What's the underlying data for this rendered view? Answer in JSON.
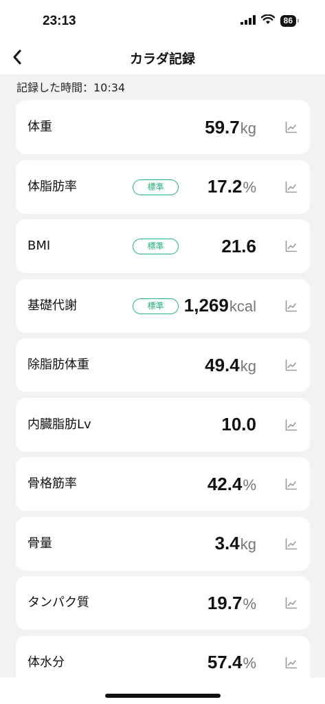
{
  "status": {
    "time": "23:13",
    "battery": "86"
  },
  "nav": {
    "title": "カラダ記録",
    "back_icon": "chevron-left-icon"
  },
  "record_time": "記録した時間：10:34",
  "colors": {
    "badge": "#2db17e",
    "unit": "#777777",
    "background": "#f2f2f2"
  },
  "metrics": [
    {
      "label": "体重",
      "badge": "",
      "value": "59.7",
      "unit": "kg"
    },
    {
      "label": "体脂肪率",
      "badge": "標準",
      "value": "17.2",
      "unit": "%"
    },
    {
      "label": "BMI",
      "badge": "標準",
      "value": "21.6",
      "unit": ""
    },
    {
      "label": "基礎代謝",
      "badge": "標準",
      "value": "1,269",
      "unit": "kcal"
    },
    {
      "label": "除脂肪体重",
      "badge": "",
      "value": "49.4",
      "unit": "kg"
    },
    {
      "label": "内臓脂肪Lv",
      "badge": "",
      "value": "10.0",
      "unit": ""
    },
    {
      "label": "骨格筋率",
      "badge": "",
      "value": "42.4",
      "unit": "%"
    },
    {
      "label": "骨量",
      "badge": "",
      "value": "3.4",
      "unit": "kg"
    },
    {
      "label": "タンパク質",
      "badge": "",
      "value": "19.7",
      "unit": "%"
    },
    {
      "label": "体水分",
      "badge": "",
      "value": "57.4",
      "unit": "%"
    }
  ]
}
